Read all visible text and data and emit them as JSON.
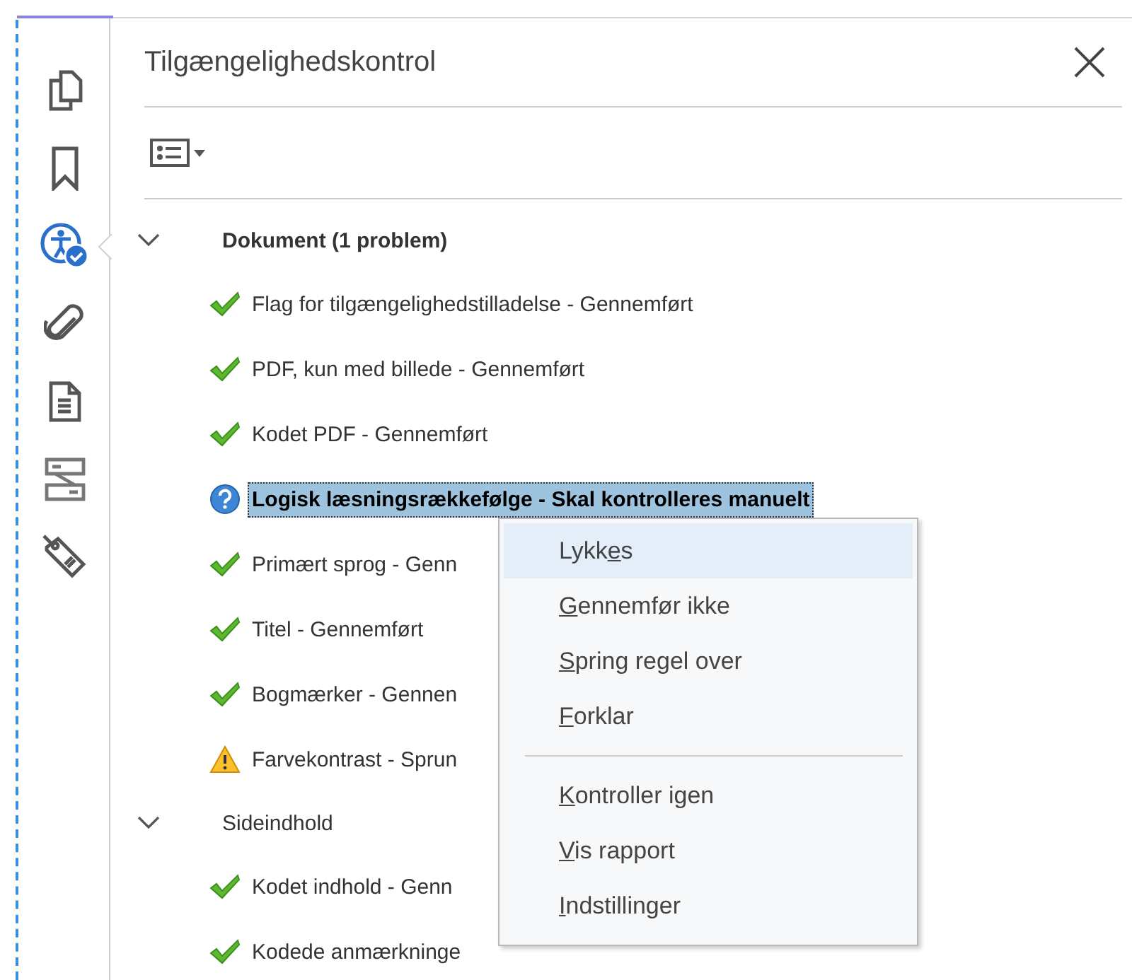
{
  "sidebar": {
    "items": [
      {
        "kind": "pages",
        "selected": false
      },
      {
        "kind": "bookmark",
        "selected": false
      },
      {
        "kind": "accessibility",
        "selected": true
      },
      {
        "kind": "attachment",
        "selected": false
      },
      {
        "kind": "document",
        "selected": false
      },
      {
        "kind": "compare",
        "selected": false
      },
      {
        "kind": "tag",
        "selected": false
      }
    ]
  },
  "panel": {
    "title": "Tilgængelighedskontrol",
    "groups": [
      {
        "label": "Dokument (1 problem)",
        "expanded": true,
        "emphasized": true,
        "items": [
          {
            "kind": "passed",
            "label": "Flag for tilgængelighedstilladelse - Gennemført",
            "selected": false
          },
          {
            "kind": "passed",
            "label": "PDF, kun med billede - Gennemført",
            "selected": false
          },
          {
            "kind": "passed",
            "label": "Kodet PDF - Gennemført",
            "selected": false
          },
          {
            "kind": "manual",
            "label": "Logisk læsningsrækkefølge - Skal kontrolleres manuelt",
            "selected": true
          },
          {
            "kind": "passed",
            "label": "Primært sprog - Genn",
            "selected": false
          },
          {
            "kind": "passed",
            "label": "Titel - Gennemført",
            "selected": false
          },
          {
            "kind": "passed",
            "label": "Bogmærker - Gennen",
            "selected": false
          },
          {
            "kind": "warning",
            "label": "Farvekontrast - Sprun",
            "selected": false
          }
        ]
      },
      {
        "label": "Sideindhold",
        "expanded": true,
        "emphasized": false,
        "items": [
          {
            "kind": "passed",
            "label": "Kodet indhold - Genn",
            "selected": false
          },
          {
            "kind": "passed",
            "label": "Kodede anmærkninge",
            "selected": false
          }
        ]
      }
    ]
  },
  "context_menu": {
    "items": [
      {
        "kind": "item",
        "pre": "Lykk",
        "key": "e",
        "post": "s",
        "highlighted": true
      },
      {
        "kind": "item",
        "key": "G",
        "post": "ennemfør ikke",
        "highlighted": false
      },
      {
        "kind": "item",
        "key": "S",
        "post": "pring regel over",
        "highlighted": false
      },
      {
        "kind": "item",
        "key": "F",
        "post": "orklar",
        "highlighted": false
      },
      {
        "kind": "separator"
      },
      {
        "kind": "item",
        "key": "K",
        "post": "ontroller igen",
        "highlighted": false
      },
      {
        "kind": "item",
        "key": "V",
        "post": "is rapport",
        "highlighted": false
      },
      {
        "kind": "item",
        "key": "I",
        "post": "ndstillinger",
        "highlighted": false
      }
    ]
  }
}
